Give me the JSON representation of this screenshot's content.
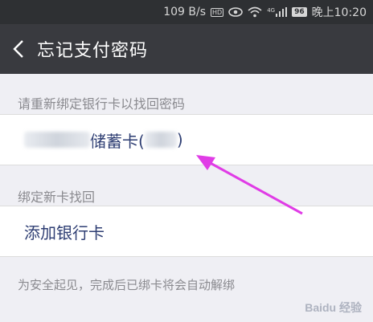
{
  "status_bar": {
    "network_speed": "109 B/s",
    "hd_label": "HD",
    "signal_label": "4G",
    "battery": "96",
    "time": "晚上10:20",
    "icons": [
      "hd-icon",
      "eye-icon",
      "wifi-icon",
      "signal-icon",
      "battery-icon"
    ]
  },
  "nav": {
    "back_icon": "chevron-left-icon",
    "title": "忘记支付密码"
  },
  "rebind_section": {
    "header": "请重新绑定银行卡以找回密码",
    "card": {
      "label_prefix": "",
      "label_visible": "储蓄卡(",
      "label_suffix": ")"
    }
  },
  "new_card_section": {
    "header": "绑定新卡找回",
    "add_label": "添加银行卡"
  },
  "footer_note": "为安全起见，完成后已绑卡将会自动解绑",
  "watermark": "Baidu 经验",
  "annotation": {
    "arrow_color": "#e03ce6"
  },
  "colors": {
    "statusbar_bg": "#2e3033",
    "navbar_bg": "#393a3f",
    "page_bg": "#efeff4",
    "cell_text": "#2e3e73",
    "header_text": "#8a8a8f"
  }
}
